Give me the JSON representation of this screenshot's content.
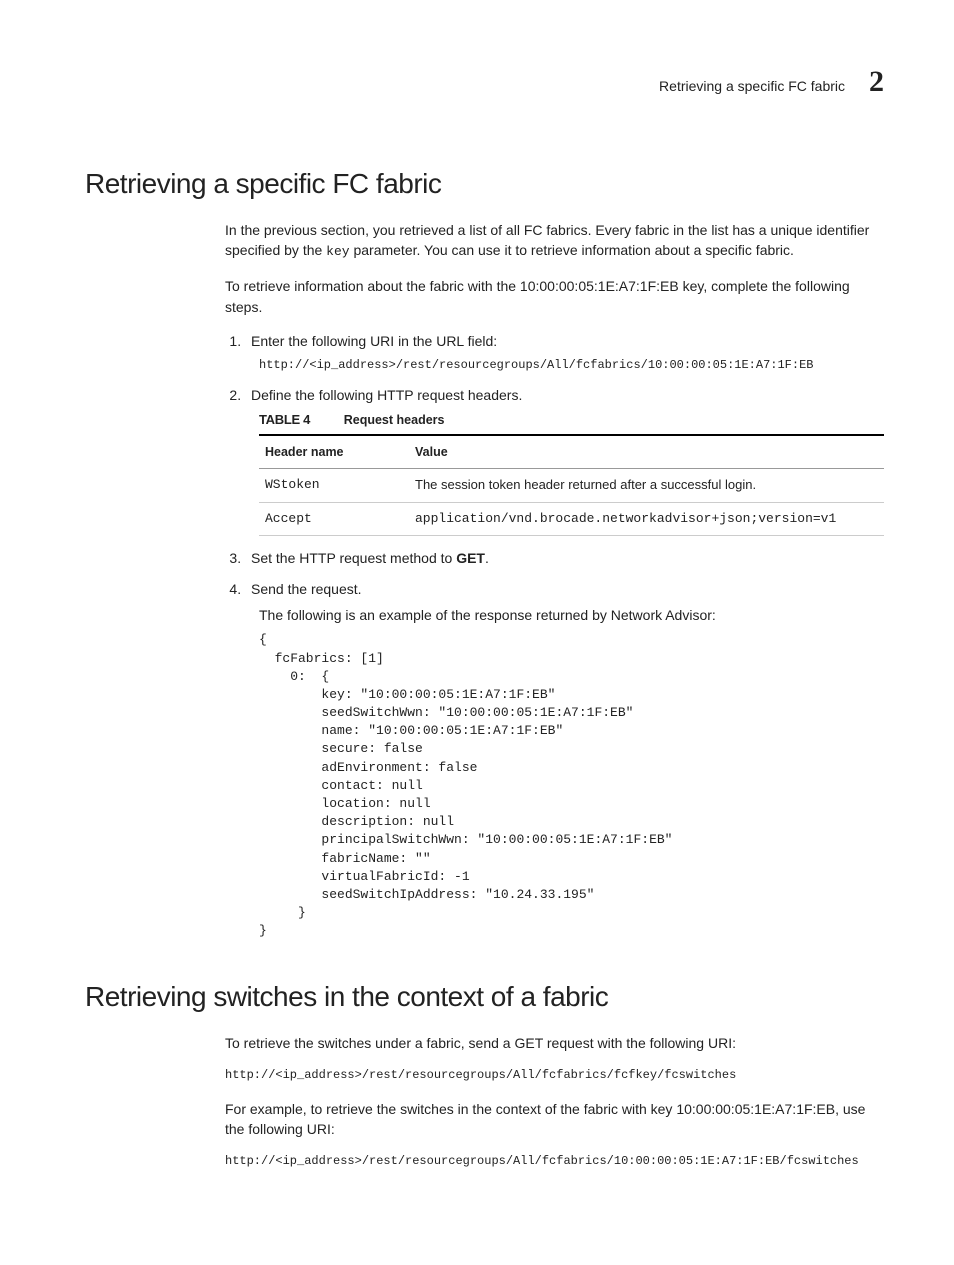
{
  "header": {
    "running_title": "Retrieving a specific FC fabric",
    "chapter_number": "2"
  },
  "section1": {
    "heading": "Retrieving a specific FC fabric",
    "intro_pre": "In the previous section, you retrieved a list of all FC fabrics. Every fabric in the list has a unique identifier specified by the ",
    "intro_key": "key",
    "intro_post": " parameter. You can use it to retrieve information about a specific fabric.",
    "lead": "To retrieve information about the fabric with the 10:00:00:05:1E:A7:1F:EB key, complete the following steps.",
    "steps": {
      "s1": {
        "text": "Enter the following URI in the URL field:",
        "uri": "http://<ip_address>/rest/resourcegroups/All/fcfabrics/10:00:00:05:1E:A7:1F:EB"
      },
      "s2": {
        "text": "Define the following HTTP request headers.",
        "table": {
          "label": "TABLE 4",
          "caption": "Request headers",
          "col1": "Header name",
          "col2": "Value",
          "rows": [
            {
              "name": "WStoken",
              "value": "The session token header returned after a successful login."
            },
            {
              "name": "Accept",
              "value_mono": "application/vnd.brocade.networkadvisor+json;version=v1"
            }
          ]
        }
      },
      "s3": {
        "pre": "Set the HTTP request method to ",
        "method": "GET",
        "post": "."
      },
      "s4": {
        "text": "Send the request.",
        "before_code": "The following is an example of the response returned by Network Advisor:",
        "code": "{\n  fcFabrics: [1]\n    0:  {\n        key: \"10:00:00:05:1E:A7:1F:EB\"\n        seedSwitchWwn: \"10:00:00:05:1E:A7:1F:EB\"\n        name: \"10:00:00:05:1E:A7:1F:EB\"\n        secure: false\n        adEnvironment: false\n        contact: null\n        location: null\n        description: null\n        principalSwitchWwn: \"10:00:00:05:1E:A7:1F:EB\"\n        fabricName: \"\"\n        virtualFabricId: -1\n        seedSwitchIpAddress: \"10.24.33.195\"\n     }\n}"
      }
    }
  },
  "section2": {
    "heading": "Retrieving switches in the context of a fabric",
    "p1": "To retrieve the switches under a fabric, send a GET request with the following URI:",
    "uri1": "http://<ip_address>/rest/resourcegroups/All/fcfabrics/fcfkey/fcswitches",
    "p2": "For example, to retrieve the switches in the context of the fabric with key 10:00:00:05:1E:A7:1F:EB, use the following URI:",
    "uri2": "http://<ip_address>/rest/resourcegroups/All/fcfabrics/10:00:00:05:1E:A7:1F:EB/fcswitches"
  }
}
